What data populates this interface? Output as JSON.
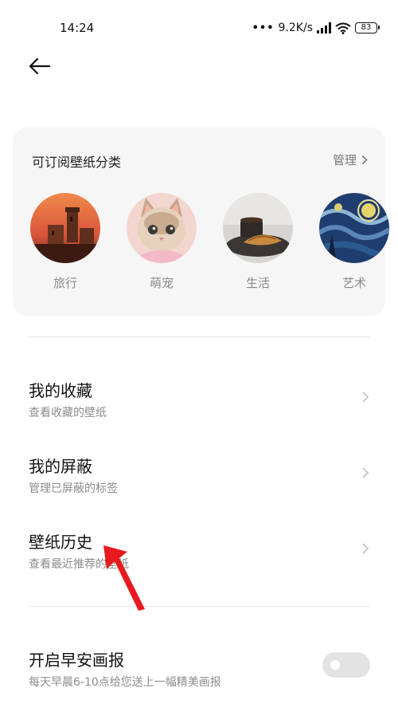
{
  "status_bar": {
    "time": "14:24",
    "network_speed": "9.2K/s",
    "battery": "83",
    "icons": [
      "signal-icon",
      "wifi-icon",
      "battery-icon"
    ]
  },
  "header": {
    "back_icon": "back-arrow-icon"
  },
  "subscription_card": {
    "title": "可订阅壁纸分类",
    "manage_label": "管理",
    "categories": [
      {
        "label": "旅行"
      },
      {
        "label": "萌宠"
      },
      {
        "label": "生活"
      },
      {
        "label": "艺术"
      }
    ]
  },
  "menu": {
    "items": [
      {
        "title": "我的收藏",
        "subtitle": "查看收藏的壁纸"
      },
      {
        "title": "我的屏蔽",
        "subtitle": "管理已屏蔽的标签"
      },
      {
        "title": "壁纸历史",
        "subtitle": "查看最近推荐的壁纸"
      }
    ]
  },
  "morning_report": {
    "title": "开启早安画报",
    "subtitle": "每天早晨6-10点给您送上一幅精美画报",
    "enabled": false
  },
  "colors": {
    "card_background": "#f6f6f6",
    "annotation_arrow": "#e8191f",
    "toggle_off": "#e3e3e3"
  }
}
